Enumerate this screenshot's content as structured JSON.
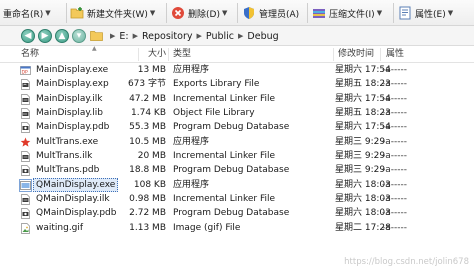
{
  "toolbar": {
    "rename": {
      "label": "重命名(R)"
    },
    "new_folder": {
      "label": "新建文件夹(W)"
    },
    "delete": {
      "label": "删除(D)"
    },
    "admin": {
      "label": "管理员(A)"
    },
    "compress": {
      "label": "压缩文件(I)"
    },
    "properties": {
      "label": "属性(E)"
    }
  },
  "address": {
    "crumbs": [
      "E:",
      "Repository",
      "Public",
      "Debug"
    ]
  },
  "columns": {
    "name": "名称",
    "size": "大小",
    "type": "类型",
    "modified": "修改时间",
    "attributes": "属性"
  },
  "files": [
    {
      "name": "MainDisplay.exe",
      "size": "13 MB",
      "type": "应用程序",
      "date": "星期六  17:54",
      "attr": "-a-----",
      "icon": "app-icon"
    },
    {
      "name": "MainDisplay.exp",
      "size": "673 字节",
      "type": "Exports Library File",
      "date": "星期五  18:23",
      "attr": "-a-----",
      "icon": "exp-file-icon"
    },
    {
      "name": "MainDisplay.ilk",
      "size": "47.2 MB",
      "type": "Incremental Linker File",
      "date": "星期六  17:54",
      "attr": "-a-----",
      "icon": "ilk-file-icon"
    },
    {
      "name": "MainDisplay.lib",
      "size": "1.74 KB",
      "type": "Object File Library",
      "date": "星期五  18:23",
      "attr": "-a-----",
      "icon": "lib-file-icon"
    },
    {
      "name": "MainDisplay.pdb",
      "size": "55.3 MB",
      "type": "Program Debug Database",
      "date": "星期六  17:54",
      "attr": "-a-----",
      "icon": "pdb-file-icon"
    },
    {
      "name": "MultTrans.exe",
      "size": "10.5 MB",
      "type": "应用程序",
      "date": "星期三  9:29",
      "attr": "-a-----",
      "icon": "multtrans-app-icon"
    },
    {
      "name": "MultTrans.ilk",
      "size": "20 MB",
      "type": "Incremental Linker File",
      "date": "星期三  9:29",
      "attr": "-a-----",
      "icon": "ilk-file-icon"
    },
    {
      "name": "MultTrans.pdb",
      "size": "18.8 MB",
      "type": "Program Debug Database",
      "date": "星期三  9:29",
      "attr": "-a-----",
      "icon": "pdb-file-icon"
    },
    {
      "name": "QMainDisplay.exe",
      "size": "108 KB",
      "type": "应用程序",
      "date": "星期六  18:03",
      "attr": "-a-----",
      "icon": "qt-app-icon"
    },
    {
      "name": "QMainDisplay.ilk",
      "size": "0.98 MB",
      "type": "Incremental Linker File",
      "date": "星期六  18:03",
      "attr": "-a-----",
      "icon": "ilk-file-icon"
    },
    {
      "name": "QMainDisplay.pdb",
      "size": "2.72 MB",
      "type": "Program Debug Database",
      "date": "星期六  18:03",
      "attr": "-a-----",
      "icon": "pdb-file-icon"
    },
    {
      "name": "waiting.gif",
      "size": "1.13 MB",
      "type": "Image (gif) File",
      "date": "星期二  17:28",
      "attr": "-a-----",
      "icon": "gif-file-icon"
    }
  ],
  "selected_index": 8,
  "watermark": "https://blog.csdn.net/jolin678",
  "colors": {
    "nav_button": "#3c9d86",
    "selection_border": "#3d6fb6",
    "selection_fill": "#dfeaf8",
    "toolbar_bg": "#eeeeee"
  }
}
